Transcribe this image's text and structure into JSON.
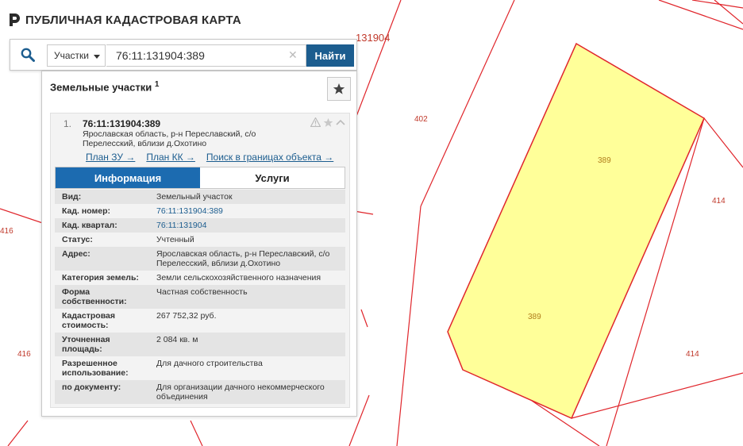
{
  "app": {
    "title": "ПУБЛИЧНАЯ КАДАСТРОВАЯ КАРТА"
  },
  "search": {
    "type_label": "Участки",
    "query": "76:11:131904:389",
    "go_label": "Найти"
  },
  "panel": {
    "title": "Земельные участки",
    "count": "1"
  },
  "result": {
    "number": "1.",
    "cadastral": "76:11:131904:389",
    "address": "Ярославская область, р-н Переславский, с/о Перелесский, вблизи д.Охотино",
    "links": [
      "План ЗУ →",
      "План КК →",
      "Поиск в границах объекта →"
    ],
    "tabs": [
      "Информация",
      "Услуги"
    ],
    "rows": [
      {
        "key": "Вид:",
        "value": "Земельный участок"
      },
      {
        "key": "Кад. номер:",
        "value": "76:11:131904:389"
      },
      {
        "key": "Кад. квартал:",
        "value": "76:11:131904"
      },
      {
        "key": "Статус:",
        "value": "Учтенный"
      },
      {
        "key": "Адрес:",
        "value": "Ярославская область, р-н Переславский, с/о Перелесский, вблизи д.Охотино"
      },
      {
        "key": "Категория земель:",
        "value": "Земли сельскохозяйственного назначения"
      },
      {
        "key": "Форма собственности:",
        "value": "Частная собственность"
      },
      {
        "key": "Кадастровая стоимость:",
        "value": "267 752,32 руб."
      },
      {
        "key": "Уточненная площадь:",
        "value": "2 084 кв. м"
      },
      {
        "key": "Разрешенное использование:",
        "value": "Для дачного строительства"
      },
      {
        "key": "по документу:",
        "value": "Для организации дачного некоммерческого объединения"
      }
    ]
  },
  "map": {
    "quarter_label": "131904",
    "labels": [
      "402",
      "389",
      "389",
      "414",
      "414",
      "416",
      "416"
    ],
    "colors": {
      "boundary": "#e0252b",
      "parcel_fill": "#ffff99",
      "parcel_text": "#b07d1a",
      "accent": "#1c5d8f"
    }
  }
}
